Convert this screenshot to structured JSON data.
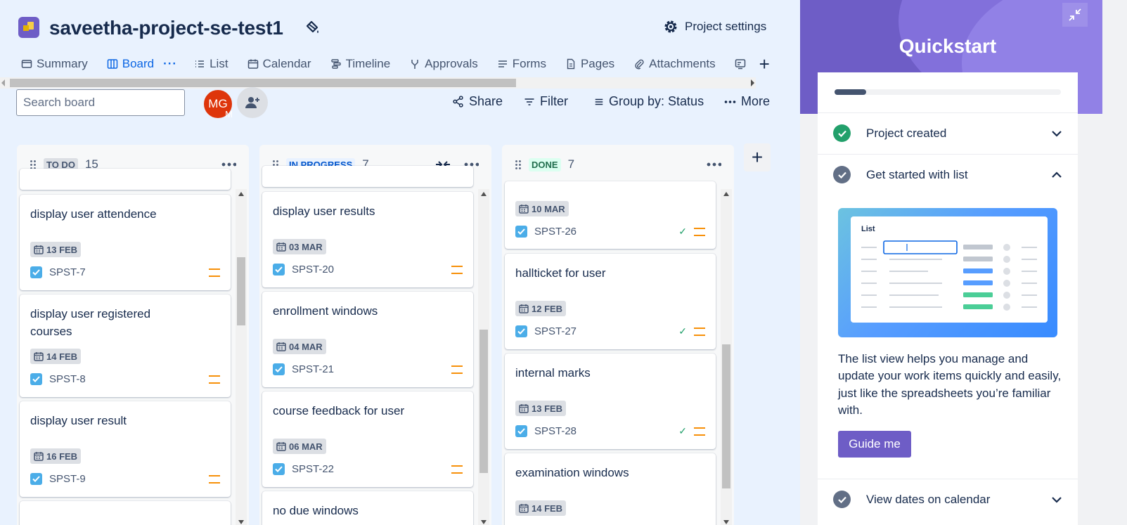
{
  "project": {
    "title": "saveetha-project-se-test1",
    "settings_label": "Project settings"
  },
  "tabs": [
    {
      "label": "Summary",
      "icon": "summary-icon"
    },
    {
      "label": "Board",
      "icon": "board-icon",
      "active": true
    },
    {
      "label": "List",
      "icon": "list-icon"
    },
    {
      "label": "Calendar",
      "icon": "calendar-icon"
    },
    {
      "label": "Timeline",
      "icon": "timeline-icon"
    },
    {
      "label": "Approvals",
      "icon": "approvals-icon"
    },
    {
      "label": "Forms",
      "icon": "forms-icon"
    },
    {
      "label": "Pages",
      "icon": "pages-icon"
    },
    {
      "label": "Attachments",
      "icon": "attachment-icon"
    }
  ],
  "tab_more": "···",
  "tab_add": "+",
  "toolbar": {
    "search_placeholder": "Search board",
    "avatar_initials": "MG",
    "avatar_badge": "M",
    "share_label": "Share",
    "filter_label": "Filter",
    "group_label": "Group by: Status",
    "more_label": "More"
  },
  "columns": [
    {
      "status": "TO DO",
      "count": "15",
      "cards": [
        {
          "title": "display user attendence",
          "date": "13 FEB",
          "key": "SPST-7",
          "priority": "medium"
        },
        {
          "title": "display user registered courses",
          "date": "14 FEB",
          "key": "SPST-8",
          "priority": "medium"
        },
        {
          "title": "display user result",
          "date": "16 FEB",
          "key": "SPST-9",
          "priority": "medium"
        }
      ]
    },
    {
      "status": "IN PROGRESS",
      "count": "7",
      "cards": [
        {
          "title": "display user results",
          "date": "03 MAR",
          "key": "SPST-20",
          "priority": "medium"
        },
        {
          "title": "enrollment windows",
          "date": "04 MAR",
          "key": "SPST-21",
          "priority": "medium"
        },
        {
          "title": "course feedback for user",
          "date": "06 MAR",
          "key": "SPST-22",
          "priority": "medium"
        },
        {
          "title": "no due windows"
        }
      ]
    },
    {
      "status": "DONE",
      "count": "7",
      "cards": [
        {
          "date": "10 MAR",
          "key": "SPST-26",
          "done": true,
          "priority": "medium"
        },
        {
          "title": "hallticket for user",
          "date": "12 FEB",
          "key": "SPST-27",
          "done": true,
          "priority": "medium"
        },
        {
          "title": "internal marks",
          "date": "13 FEB",
          "key": "SPST-28",
          "done": true,
          "priority": "medium"
        },
        {
          "title": "examination windows",
          "date": "14 FEB"
        }
      ]
    }
  ],
  "quickstart": {
    "title": "Quickstart",
    "progress": 0.14,
    "steps": [
      {
        "label": "Project created",
        "state": "complete"
      },
      {
        "label": "Get started with list",
        "state": "expanded"
      },
      {
        "label": "View dates on calendar",
        "state": "collapsed"
      }
    ],
    "illustration_label": "List",
    "description": "The list view helps you manage and update your work items quickly and easily, just like the spreadsheets you’re familiar with.",
    "guide_label": "Guide me"
  },
  "colors": {
    "accent": "#0c66e4",
    "quickstart": "#6e5dc6",
    "priority_medium": "#f79009",
    "done_check": "#22a06b",
    "canvas": "#e9f2fe"
  }
}
